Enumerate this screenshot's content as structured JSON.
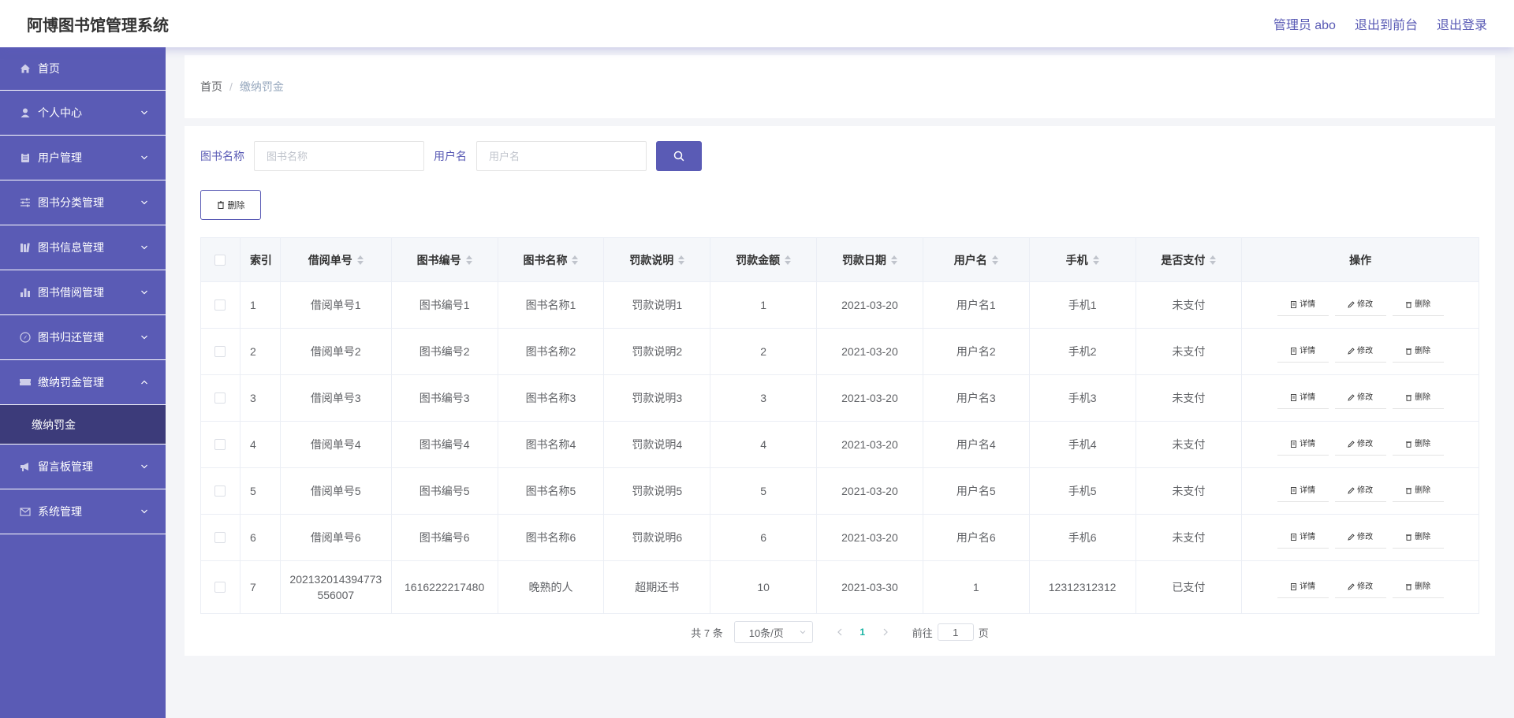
{
  "header": {
    "title": "阿博图书馆管理系统",
    "admin_label": "管理员 abo",
    "to_front": "退出到前台",
    "logout": "退出登录"
  },
  "sidebar": {
    "items": [
      {
        "label": "首页",
        "icon": "home-icon"
      },
      {
        "label": "个人中心",
        "icon": "user-icon"
      },
      {
        "label": "用户管理",
        "icon": "clipboard-icon"
      },
      {
        "label": "图书分类管理",
        "icon": "sliders-icon"
      },
      {
        "label": "图书信息管理",
        "icon": "books-icon"
      },
      {
        "label": "图书借阅管理",
        "icon": "bar-chart-icon"
      },
      {
        "label": "图书归还管理",
        "icon": "compass-icon"
      },
      {
        "label": "缴纳罚金管理",
        "icon": "ticket-icon"
      },
      {
        "label": "留言板管理",
        "icon": "megaphone-icon"
      },
      {
        "label": "系统管理",
        "icon": "mail-icon"
      }
    ],
    "submenu": {
      "label": "缴纳罚金"
    }
  },
  "breadcrumb": {
    "home": "首页",
    "separator": "/",
    "current": "缴纳罚金"
  },
  "search": {
    "book_name_label": "图书名称",
    "book_name_placeholder": "图书名称",
    "username_label": "用户名",
    "username_placeholder": "用户名"
  },
  "toolbar": {
    "delete_label": "删除"
  },
  "table": {
    "headers": [
      "索引",
      "借阅单号",
      "图书编号",
      "图书名称",
      "罚款说明",
      "罚款金额",
      "罚款日期",
      "用户名",
      "手机",
      "是否支付",
      "操作"
    ],
    "rows": [
      {
        "index": "1",
        "borrow_no": "借阅单号1",
        "book_no": "图书编号1",
        "book_name": "图书名称1",
        "fine_desc": "罚款说明1",
        "amount": "1",
        "date": "2021-03-20",
        "username": "用户名1",
        "phone": "手机1",
        "paid": "未支付"
      },
      {
        "index": "2",
        "borrow_no": "借阅单号2",
        "book_no": "图书编号2",
        "book_name": "图书名称2",
        "fine_desc": "罚款说明2",
        "amount": "2",
        "date": "2021-03-20",
        "username": "用户名2",
        "phone": "手机2",
        "paid": "未支付"
      },
      {
        "index": "3",
        "borrow_no": "借阅单号3",
        "book_no": "图书编号3",
        "book_name": "图书名称3",
        "fine_desc": "罚款说明3",
        "amount": "3",
        "date": "2021-03-20",
        "username": "用户名3",
        "phone": "手机3",
        "paid": "未支付"
      },
      {
        "index": "4",
        "borrow_no": "借阅单号4",
        "book_no": "图书编号4",
        "book_name": "图书名称4",
        "fine_desc": "罚款说明4",
        "amount": "4",
        "date": "2021-03-20",
        "username": "用户名4",
        "phone": "手机4",
        "paid": "未支付"
      },
      {
        "index": "5",
        "borrow_no": "借阅单号5",
        "book_no": "图书编号5",
        "book_name": "图书名称5",
        "fine_desc": "罚款说明5",
        "amount": "5",
        "date": "2021-03-20",
        "username": "用户名5",
        "phone": "手机5",
        "paid": "未支付"
      },
      {
        "index": "6",
        "borrow_no": "借阅单号6",
        "book_no": "图书编号6",
        "book_name": "图书名称6",
        "fine_desc": "罚款说明6",
        "amount": "6",
        "date": "2021-03-20",
        "username": "用户名6",
        "phone": "手机6",
        "paid": "未支付"
      },
      {
        "index": "7",
        "borrow_no": "202132014394773556007",
        "book_no": "1616222217480",
        "book_name": "晚熟的人",
        "fine_desc": "超期还书",
        "amount": "10",
        "date": "2021-03-30",
        "username": "1",
        "phone": "12312312312",
        "paid": "已支付"
      }
    ],
    "actions": {
      "detail": "详情",
      "edit": "修改",
      "delete": "删除"
    }
  },
  "pagination": {
    "total": "共 7 条",
    "page_size": "10条/页",
    "current_page": "1",
    "goto_label": "前往",
    "goto_value": "1",
    "page_suffix": "页"
  },
  "colors": {
    "accent": "#5a5bb5",
    "sidebar_active": "#3c3b7a",
    "pager_active": "#17b3a3"
  }
}
